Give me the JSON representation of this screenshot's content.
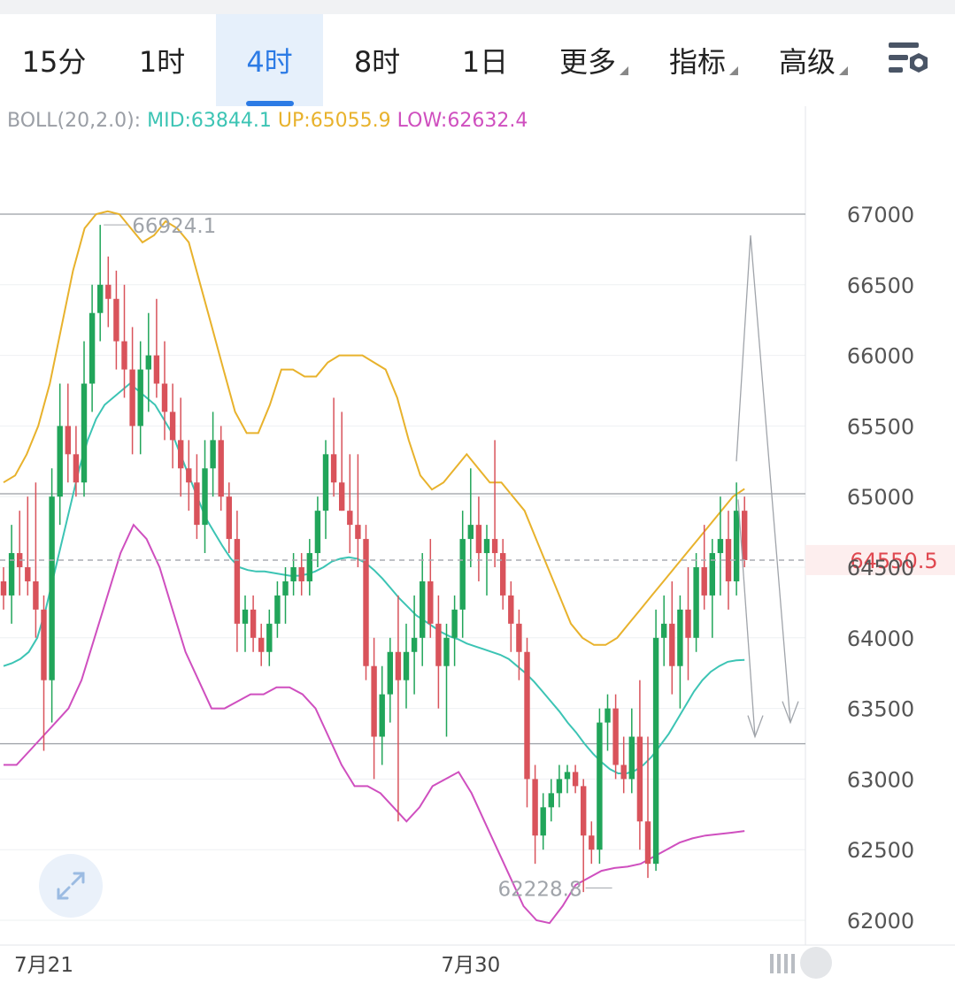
{
  "tabs": [
    {
      "label": "15分",
      "active": false
    },
    {
      "label": "1时",
      "active": false
    },
    {
      "label": "4时",
      "active": true
    },
    {
      "label": "8时",
      "active": false
    },
    {
      "label": "1日",
      "active": false
    },
    {
      "label": "更多",
      "dropdown": true
    },
    {
      "label": "指标",
      "dropdown": true
    },
    {
      "label": "高级",
      "dropdown": true
    }
  ],
  "settings_icon": "chart-settings-icon",
  "indicator": {
    "name": "BOLL(20,2.0):",
    "mid": "MID:63844.1",
    "up": "UP:65055.9",
    "low": "LOW:62632.4"
  },
  "expand_icon": "expand-icon",
  "colors": {
    "up_candle": "#21a55a",
    "down_candle": "#d9535b",
    "mid_line": "#3cc4b4",
    "upper_band": "#e8b22c",
    "lower_band": "#cf4fbf",
    "accent": "#2c7be5",
    "current_price": "#e0474f"
  },
  "chart_data": {
    "type": "candlestick",
    "title": "",
    "interval": "4时",
    "yticks": [
      67000,
      66500,
      66000,
      65500,
      65000,
      64500,
      64000,
      63500,
      63000,
      62500,
      62000
    ],
    "ylim": [
      61800,
      67500
    ],
    "xticks": [
      {
        "label": "7月21",
        "index": 5
      },
      {
        "label": "7月30",
        "index": 58
      }
    ],
    "current_price": 64550.5,
    "current_price_label": "64550.5",
    "high_marker": {
      "value": 66924.1,
      "label": "66924.1",
      "index": 12
    },
    "low_marker": {
      "value": 62228.8,
      "label": "62228.8",
      "index": 76
    },
    "horizontal_lines": [
      67000,
      65020,
      63250
    ],
    "candles_ohlc": [
      [
        64400,
        64500,
        64200,
        64300
      ],
      [
        64300,
        64800,
        64100,
        64600
      ],
      [
        64600,
        64900,
        64300,
        64500
      ],
      [
        64500,
        65000,
        64300,
        64400
      ],
      [
        64400,
        65100,
        64000,
        64200
      ],
      [
        64200,
        64300,
        63200,
        63700
      ],
      [
        63700,
        65200,
        63400,
        65000
      ],
      [
        65000,
        65800,
        64800,
        65500
      ],
      [
        65500,
        65800,
        65100,
        65300
      ],
      [
        65300,
        65500,
        65000,
        65100
      ],
      [
        65100,
        66100,
        65000,
        65800
      ],
      [
        65800,
        66500,
        65600,
        66300
      ],
      [
        66300,
        66924,
        66100,
        66500
      ],
      [
        66500,
        66700,
        66200,
        66400
      ],
      [
        66400,
        66600,
        65900,
        66100
      ],
      [
        66100,
        66500,
        65700,
        65900
      ],
      [
        65900,
        66200,
        65300,
        65500
      ],
      [
        65500,
        66100,
        65300,
        65900
      ],
      [
        65900,
        66300,
        65600,
        66000
      ],
      [
        66000,
        66400,
        65700,
        65800
      ],
      [
        65800,
        66100,
        65400,
        65600
      ],
      [
        65600,
        65800,
        65200,
        65400
      ],
      [
        65400,
        65700,
        65000,
        65200
      ],
      [
        65200,
        65400,
        64900,
        65100
      ],
      [
        65100,
        65300,
        64700,
        64800
      ],
      [
        64800,
        65400,
        64600,
        65200
      ],
      [
        65200,
        65600,
        65000,
        65400
      ],
      [
        65400,
        65500,
        64900,
        65000
      ],
      [
        65000,
        65100,
        64600,
        64700
      ],
      [
        64700,
        64900,
        63900,
        64100
      ],
      [
        64100,
        64300,
        63900,
        64200
      ],
      [
        64200,
        64300,
        63900,
        64000
      ],
      [
        64000,
        64100,
        63800,
        63900
      ],
      [
        63900,
        64200,
        63800,
        64100
      ],
      [
        64100,
        64400,
        64000,
        64300
      ],
      [
        64300,
        64500,
        64100,
        64400
      ],
      [
        64400,
        64600,
        64300,
        64500
      ],
      [
        64500,
        64600,
        64300,
        64400
      ],
      [
        64400,
        64700,
        64300,
        64600
      ],
      [
        64600,
        65000,
        64500,
        64900
      ],
      [
        64900,
        65400,
        64700,
        65300
      ],
      [
        65300,
        65700,
        65000,
        65100
      ],
      [
        65100,
        65600,
        64900,
        64900
      ],
      [
        64900,
        65300,
        64600,
        64800
      ],
      [
        64800,
        65300,
        64500,
        64700
      ],
      [
        64700,
        64800,
        63700,
        63800
      ],
      [
        63800,
        64000,
        63000,
        63300
      ],
      [
        63300,
        63800,
        63100,
        63600
      ],
      [
        63600,
        64000,
        63400,
        63900
      ],
      [
        63900,
        64300,
        62700,
        63700
      ],
      [
        63700,
        64100,
        63500,
        63900
      ],
      [
        63900,
        64300,
        63600,
        64000
      ],
      [
        64000,
        64600,
        63800,
        64400
      ],
      [
        64400,
        64700,
        64000,
        64100
      ],
      [
        64100,
        64300,
        63500,
        63800
      ],
      [
        63800,
        64100,
        63300,
        64000
      ],
      [
        64000,
        64300,
        63800,
        64200
      ],
      [
        64200,
        64900,
        64000,
        64700
      ],
      [
        64700,
        65200,
        64500,
        64800
      ],
      [
        64800,
        65000,
        64400,
        64600
      ],
      [
        64600,
        64800,
        64300,
        64700
      ],
      [
        64700,
        65400,
        64500,
        64600
      ],
      [
        64600,
        64700,
        64200,
        64300
      ],
      [
        64300,
        64400,
        63900,
        64100
      ],
      [
        64100,
        64200,
        63700,
        63900
      ],
      [
        63900,
        64000,
        62800,
        63000
      ],
      [
        63000,
        63100,
        62400,
        62600
      ],
      [
        62600,
        62900,
        62500,
        62800
      ],
      [
        62800,
        63000,
        62700,
        62900
      ],
      [
        62900,
        63100,
        62800,
        63000
      ],
      [
        63000,
        63100,
        62900,
        63050
      ],
      [
        63050,
        63100,
        62900,
        62950
      ],
      [
        62950,
        63000,
        62200,
        62600
      ],
      [
        62600,
        62700,
        62400,
        62500
      ],
      [
        62500,
        63500,
        62400,
        63400
      ],
      [
        63400,
        63600,
        63200,
        63500
      ],
      [
        63500,
        63600,
        63000,
        63100
      ],
      [
        63100,
        63300,
        62900,
        63000
      ],
      [
        63000,
        63500,
        62900,
        63300
      ],
      [
        63300,
        63700,
        62500,
        62700
      ],
      [
        62700,
        63300,
        62300,
        62400
      ],
      [
        62400,
        64200,
        62350,
        64000
      ],
      [
        64000,
        64300,
        63800,
        64100
      ],
      [
        64100,
        64400,
        63600,
        63800
      ],
      [
        63800,
        64300,
        63500,
        64200
      ],
      [
        64200,
        64500,
        63700,
        64000
      ],
      [
        64000,
        64600,
        63900,
        64500
      ],
      [
        64500,
        64800,
        64200,
        64300
      ],
      [
        64300,
        64700,
        64000,
        64600
      ],
      [
        64600,
        65000,
        64300,
        64700
      ],
      [
        64700,
        64900,
        64200,
        64400
      ],
      [
        64400,
        65100,
        64300,
        64900
      ],
      [
        64900,
        65000,
        64500,
        64550
      ]
    ],
    "series": [
      {
        "name": "MID",
        "values": [
          63800,
          63820,
          63850,
          63900,
          64000,
          64200,
          64450,
          64700,
          64950,
          65200,
          65400,
          65550,
          65650,
          65700,
          65750,
          65800,
          65750,
          65700,
          65650,
          65550,
          65450,
          65300,
          65150,
          65000,
          64850,
          64750,
          64650,
          64560,
          64500,
          64480,
          64470,
          64470,
          64460,
          64450,
          64440,
          64440,
          64450,
          64470,
          64500,
          64540,
          64560,
          64570,
          64560,
          64530,
          64480,
          64420,
          64350,
          64280,
          64220,
          64160,
          64120,
          64080,
          64040,
          64010,
          63990,
          63960,
          63940,
          63920,
          63900,
          63880,
          63850,
          63800,
          63750,
          63690,
          63620,
          63550,
          63480,
          63400,
          63330,
          63250,
          63180,
          63120,
          63070,
          63040,
          63040,
          63060,
          63100,
          63160,
          63240,
          63320,
          63420,
          63520,
          63620,
          63700,
          63760,
          63800,
          63830,
          63840,
          63844
        ]
      },
      {
        "name": "UP",
        "values": [
          65100,
          65150,
          65300,
          65500,
          65800,
          66200,
          66600,
          66900,
          67000,
          67020,
          67000,
          66900,
          66800,
          66850,
          66950,
          66900,
          66800,
          66500,
          66200,
          65900,
          65600,
          65450,
          65450,
          65650,
          65900,
          65900,
          65850,
          65850,
          65950,
          66000,
          66000,
          66000,
          65950,
          65900,
          65700,
          65400,
          65150,
          65050,
          65100,
          65200,
          65300,
          65200,
          65100,
          65100,
          65000,
          64900,
          64700,
          64500,
          64300,
          64100,
          64000,
          63950,
          63950,
          64000,
          64100,
          64200,
          64300,
          64400,
          64500,
          64600,
          64700,
          64800,
          64900,
          65000,
          65055
        ]
      },
      {
        "name": "LOW",
        "values": [
          63100,
          63100,
          63200,
          63300,
          63400,
          63500,
          63700,
          64000,
          64300,
          64600,
          64800,
          64700,
          64500,
          64200,
          63900,
          63700,
          63500,
          63500,
          63550,
          63600,
          63600,
          63650,
          63650,
          63600,
          63500,
          63300,
          63100,
          62950,
          62950,
          62900,
          62800,
          62700,
          62800,
          62950,
          63000,
          63050,
          62900,
          62700,
          62500,
          62300,
          62100,
          62000,
          61980,
          62100,
          62250,
          62300,
          62350,
          62370,
          62380,
          62400,
          62450,
          62500,
          62550,
          62580,
          62600,
          62610,
          62620,
          62632
        ]
      }
    ]
  }
}
